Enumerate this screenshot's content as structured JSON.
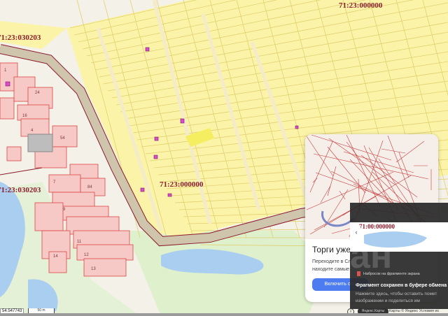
{
  "map": {
    "cadastral_labels": [
      {
        "text": "71:23:000000"
      },
      {
        "text": "71:23:030203"
      },
      {
        "text": "71:23:000000"
      },
      {
        "text": "71:23:030203"
      },
      {
        "text": "71:00:000000"
      }
    ],
    "plot_numbers": [
      "1",
      "24",
      "16",
      "4",
      "54",
      "84",
      "7",
      "9",
      "11",
      "12",
      "13",
      "14"
    ],
    "colors": {
      "parcels": "#fbf4a8",
      "parcel_lines": "#e2cf70",
      "road": "#cfc5ad",
      "road_border": "#8b1a2b",
      "water": "#a9cef0",
      "green": "#d6f0c0",
      "urban": "#f7c9c6"
    },
    "coordinate_readout": "54.547743",
    "scale_label": "50 m",
    "attribution": "Карты © Яндекс  Условия ис",
    "pill_label": "Яндекс.Карты"
  },
  "promo_card": {
    "title": "Торги уже н",
    "text_line1": "Переходите в Сл",
    "text_line2": "находите самые",
    "button": "Включить сло"
  },
  "snip_notification": {
    "app_name": "Набросок на фрагменте экрана",
    "title": "Фрагмент сохранен в буфере обмена",
    "body_line1": "Нажмите здесь, чтобы оставить помет",
    "body_line2": "изображении и поделиться им",
    "watermark": "ан"
  }
}
